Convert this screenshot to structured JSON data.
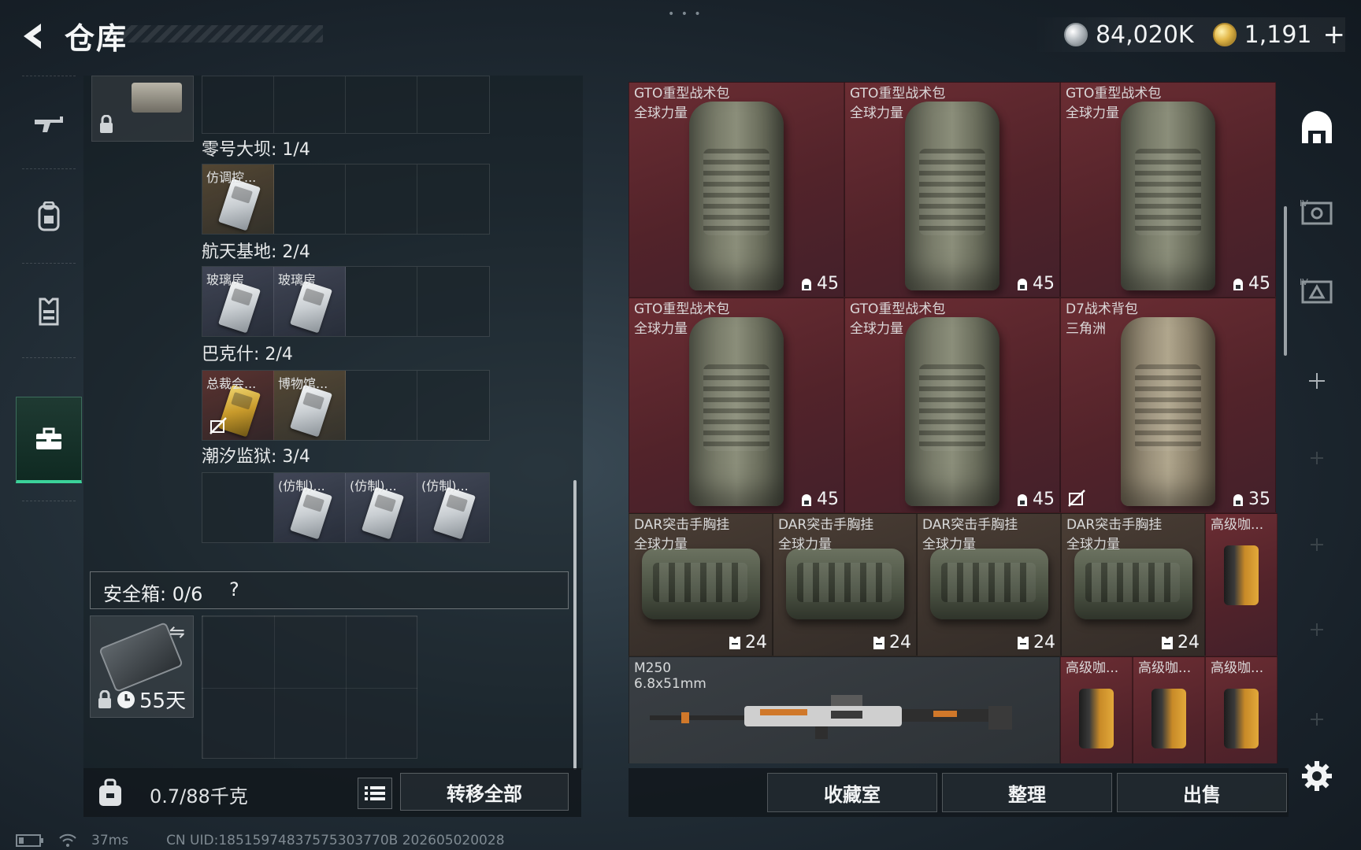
{
  "header": {
    "title": "仓库",
    "drag_handle": "• • •",
    "silver_amount": "84,020K",
    "gold_amount": "1,191",
    "add_label": "+"
  },
  "left_nav": {
    "items": [
      {
        "icon": "rifle-icon"
      },
      {
        "icon": "backpack-icon"
      },
      {
        "icon": "vest-icon"
      },
      {
        "icon": "toolbox-icon",
        "active": true
      }
    ]
  },
  "key_sections": [
    {
      "label": "零号大坝: 1/4",
      "slots": [
        {
          "name": "仿调控...",
          "tone": "amber",
          "card": "silver"
        },
        null,
        null,
        null
      ]
    },
    {
      "label": "航天基地: 2/4",
      "slots": [
        {
          "name": "玻璃房",
          "tone": "violet",
          "card": "silver"
        },
        {
          "name": "玻璃房",
          "tone": "violet",
          "card": "silver"
        },
        null,
        null
      ]
    },
    {
      "label": "巴克什: 2/4",
      "slots": [
        {
          "name": "总裁会...",
          "tone": "red",
          "card": "gold",
          "no_trade": true
        },
        {
          "name": "博物馆...",
          "tone": "amber",
          "card": "silver"
        },
        null,
        null
      ]
    },
    {
      "label": "潮汐监狱: 3/4",
      "slots": [
        null,
        {
          "name": "(仿制)...",
          "tone": "violet",
          "card": "silver"
        },
        {
          "name": "(仿制)...",
          "tone": "violet",
          "card": "silver"
        },
        {
          "name": "(仿制)...",
          "tone": "violet",
          "card": "silver"
        }
      ]
    }
  ],
  "safebox": {
    "label": "安全箱:  0/6",
    "help": "?",
    "duration": "55天"
  },
  "bottom_left": {
    "weight": "0.7/88千克",
    "transfer_all": "转移全部"
  },
  "stash_items": {
    "bags": [
      {
        "name": "GTO重型战术包",
        "sub": "全球力量",
        "count": "45",
        "tan": false
      },
      {
        "name": "GTO重型战术包",
        "sub": "全球力量",
        "count": "45",
        "tan": false
      },
      {
        "name": "GTO重型战术包",
        "sub": "全球力量",
        "count": "45",
        "tan": false
      },
      {
        "name": "GTO重型战术包",
        "sub": "全球力量",
        "count": "45",
        "tan": false
      },
      {
        "name": "GTO重型战术包",
        "sub": "全球力量",
        "count": "45",
        "tan": false
      },
      {
        "name": "D7战术背包",
        "sub": "三角洲",
        "count": "35",
        "tan": true,
        "no_trade": true
      }
    ],
    "rigs": [
      {
        "name": "DAR突击手胸挂",
        "sub": "全球力量",
        "count": "24"
      },
      {
        "name": "DAR突击手胸挂",
        "sub": "全球力量",
        "count": "24"
      },
      {
        "name": "DAR突击手胸挂",
        "sub": "全球力量",
        "count": "24"
      },
      {
        "name": "DAR突击手胸挂",
        "sub": "全球力量",
        "count": "24"
      }
    ],
    "coffee_top": {
      "name": "高级咖..."
    },
    "weapon": {
      "name": "M250",
      "sub": "6.8x51mm"
    },
    "coffee_bottom": [
      {
        "name": "高级咖..."
      },
      {
        "name": "高级咖..."
      },
      {
        "name": "高级咖..."
      }
    ]
  },
  "bottom_right": {
    "collection": "收藏室",
    "organize": "整理",
    "sell": "出售"
  },
  "footer": {
    "ping": "37ms",
    "uid": "CN UID:18515974837575303770B 202605020028"
  },
  "colors": {
    "accent_green": "#3bd29a",
    "cell_maroon": "#5a262d",
    "cell_brown": "#3e342e"
  }
}
